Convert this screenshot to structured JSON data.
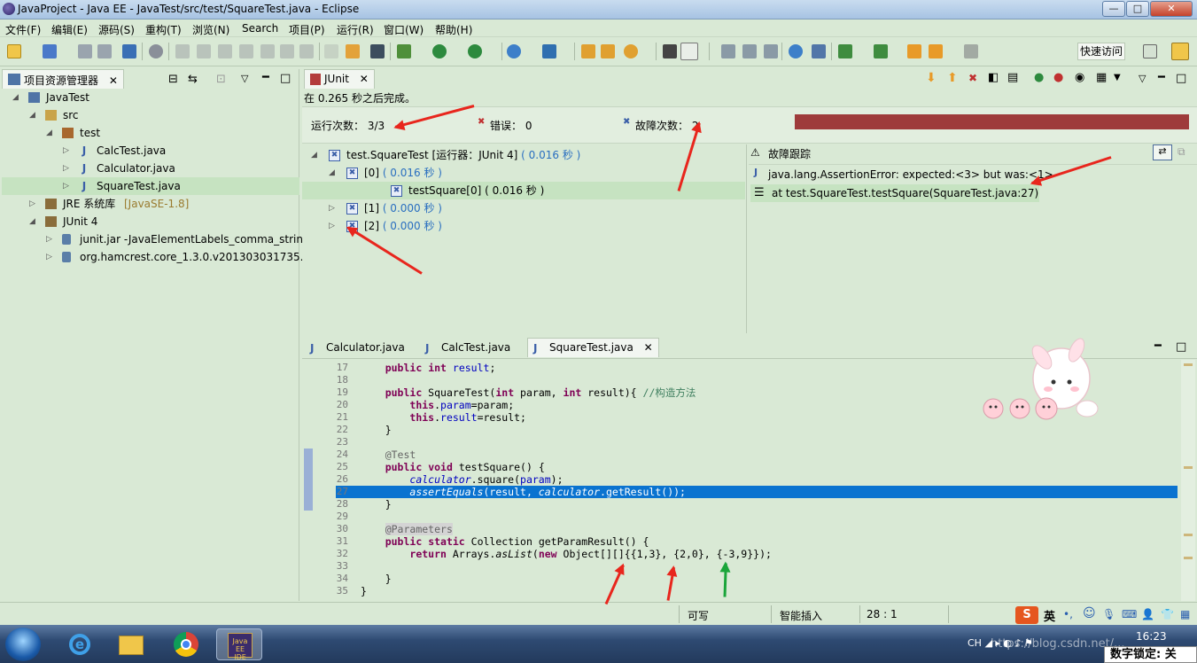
{
  "window": {
    "title": "JavaProject - Java EE - JavaTest/src/test/SquareTest.java - Eclipse",
    "min": "—",
    "max": "□",
    "close": "✕"
  },
  "menu": [
    "文件(F)",
    "编辑(E)",
    "源码(S)",
    "重构(T)",
    "浏览(N)",
    "Search",
    "项目(P)",
    "运行(R)",
    "窗口(W)",
    "帮助(H)"
  ],
  "toolbar": {
    "quick_access": "快速访问"
  },
  "explorer": {
    "tab_label": "项目资源管理器",
    "items": [
      {
        "label": "JavaTest",
        "indent": 0,
        "expanded": true,
        "icon": "project-icon"
      },
      {
        "label": "src",
        "indent": 1,
        "expanded": true,
        "icon": "source-folder-icon"
      },
      {
        "label": "test",
        "indent": 2,
        "expanded": true,
        "icon": "package-icon"
      },
      {
        "label": "CalcTest.java",
        "indent": 3,
        "expanded": false,
        "icon": "java-file-icon"
      },
      {
        "label": "Calculator.java",
        "indent": 3,
        "expanded": false,
        "icon": "java-file-icon"
      },
      {
        "label": "SquareTest.java",
        "indent": 3,
        "expanded": false,
        "icon": "java-file-icon",
        "selected": true
      },
      {
        "label": "JRE 系统库",
        "suffix": "[JavaSE-1.8]",
        "indent": 1,
        "expanded": false,
        "icon": "library-icon"
      },
      {
        "label": "JUnit 4",
        "indent": 1,
        "expanded": true,
        "icon": "library-icon"
      },
      {
        "label": "junit.jar -JavaElementLabels_comma_string=",
        "indent": 2,
        "expanded": false,
        "icon": "jar-icon"
      },
      {
        "label": "org.hamcrest.core_1.3.0.v201303031735.jar",
        "indent": 2,
        "expanded": false,
        "icon": "jar-icon"
      }
    ]
  },
  "junit": {
    "tab_label": "JUnit",
    "finished": "在 0.265 秒之后完成。",
    "runs_label": "运行次数：",
    "runs_value": "3/3",
    "errors_label": "错误：",
    "errors_value": "0",
    "failures_label": "故障次数：",
    "failures_value": "2",
    "progress_color": "#9e3b3b",
    "tree": [
      {
        "label": "test.SquareTest",
        "runner": "[运行器：JUnit 4]",
        "time": "( 0.016 秒 )",
        "indent": 0,
        "expanded": true
      },
      {
        "label": "[0]",
        "time": "( 0.016 秒 )",
        "indent": 1,
        "expanded": true
      },
      {
        "label": "testSquare[0]",
        "time": "( 0.016 秒 )",
        "indent": 2,
        "selected": true
      },
      {
        "label": "[1]",
        "time": "( 0.000 秒 )",
        "indent": 1,
        "expanded": false
      },
      {
        "label": "[2]",
        "time": "( 0.000 秒 )",
        "indent": 1,
        "expanded": false
      }
    ],
    "trace_label": "故障跟踪",
    "trace": [
      "java.lang.AssertionError: expected:<3> but was:<1>",
      "at test.SquareTest.testSquare(SquareTest.java:27)"
    ]
  },
  "editor": {
    "tabs": [
      "Calculator.java",
      "CalcTest.java",
      "SquareTest.java"
    ],
    "lines": [
      {
        "n": "17",
        "html": "    <span class='kw'>public</span> <span class='kw'>int</span> <span class='fld'>result</span>;"
      },
      {
        "n": "18",
        "html": ""
      },
      {
        "n": "19",
        "html": "    <span class='kw'>public</span> SquareTest(<span class='kw'>int</span> param, <span class='kw'>int</span> result){ <span class='cm'>//构造方法</span>"
      },
      {
        "n": "20",
        "html": "        <span class='kw'>this</span>.<span class='fld'>param</span>=param;"
      },
      {
        "n": "21",
        "html": "        <span class='kw'>this</span>.<span class='fld'>result</span>=result;"
      },
      {
        "n": "22",
        "html": "    }"
      },
      {
        "n": "23",
        "html": ""
      },
      {
        "n": "24",
        "html": "    <span class='an'>@Test</span>"
      },
      {
        "n": "25",
        "html": "    <span class='kw'>public</span> <span class='kw'>void</span> testSquare() {"
      },
      {
        "n": "26",
        "html": "        <span class='fld it'>calculator</span>.square(<span class='fld'>param</span>);"
      },
      {
        "n": "27",
        "html": "        <span class='it'>assertEquals</span>(result, <span class='it'>calculator</span>.getResult());",
        "hl": true
      },
      {
        "n": "28",
        "html": "    }"
      },
      {
        "n": "29",
        "html": ""
      },
      {
        "n": "30",
        "html": "    <span class='an' style='background:#d4d4d4'>@Parameters</span>"
      },
      {
        "n": "31",
        "html": "    <span class='kw'>public</span> <span class='kw'>static</span> Collection getParamResult() {"
      },
      {
        "n": "32",
        "html": "        <span class='kw'>return</span> Arrays.<span class='it'>asList</span>(<span class='kw'>new</span> Object[][]{{1,3}, {2,0}, {-3,9}});"
      },
      {
        "n": "33",
        "html": ""
      },
      {
        "n": "34",
        "html": "    }"
      },
      {
        "n": "35",
        "html": "}"
      }
    ]
  },
  "status": {
    "writable": "可写",
    "insert": "智能插入",
    "position": "28 : 1"
  },
  "taskbar": {
    "time": "16:23",
    "ime": "英",
    "watermark": "https://blog.csdn.net/...",
    "numlock": "数字锁定: 关"
  }
}
